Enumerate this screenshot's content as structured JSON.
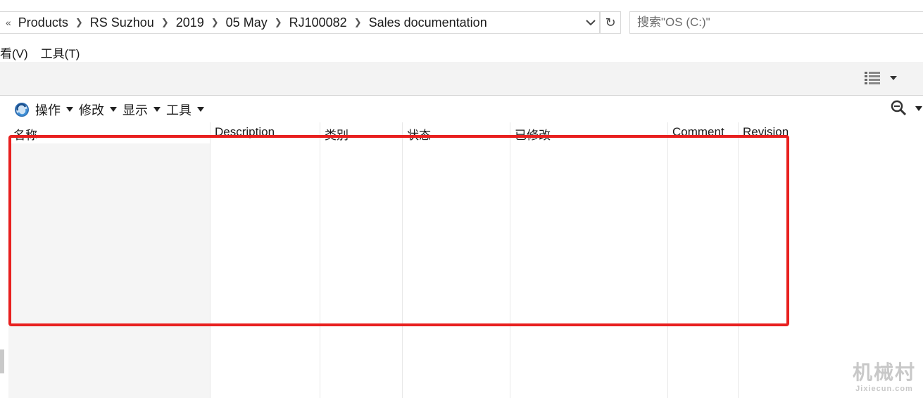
{
  "address_bar": {
    "prev_glyph": "«",
    "breadcrumbs": [
      "Products",
      "RS Suzhou",
      "2019",
      "05 May",
      "RJ100082",
      "Sales documentation"
    ],
    "refresh_glyph": "↻"
  },
  "search": {
    "placeholder": "搜索\"OS (C:)\""
  },
  "menu": {
    "items": [
      "看(V)",
      "工具(T)"
    ]
  },
  "toolbar": {
    "items": [
      "操作",
      "修改",
      "显示",
      "工具"
    ]
  },
  "table": {
    "columns": [
      "名称",
      "Description",
      "类别",
      "状态",
      "已修改",
      "Comment",
      "Revision"
    ]
  },
  "watermark": {
    "title": "机械村",
    "url": "Jixiecun.com"
  },
  "colors": {
    "highlight": "#e8201f",
    "ribbon": "#f3f3f3",
    "name_column": "#f5f5f5"
  }
}
